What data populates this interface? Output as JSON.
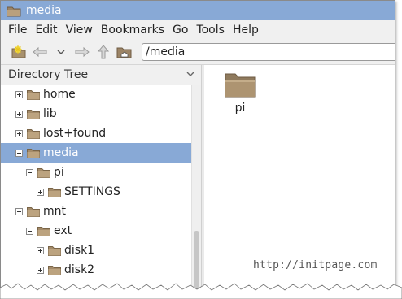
{
  "window": {
    "title": "media"
  },
  "menu": {
    "items": [
      "File",
      "Edit",
      "View",
      "Bookmarks",
      "Go",
      "Tools",
      "Help"
    ]
  },
  "toolbar": {
    "icons": [
      "new-tab-icon",
      "back-icon",
      "history-dropdown-icon",
      "forward-icon",
      "up-icon",
      "home-icon"
    ],
    "path": "/media"
  },
  "sidebar": {
    "header": "Directory Tree",
    "items": [
      {
        "label": "home",
        "expander": "+",
        "selected": false
      },
      {
        "label": "lib",
        "expander": "+",
        "selected": false
      },
      {
        "label": "lost+found",
        "expander": "+",
        "selected": false
      },
      {
        "label": "media",
        "expander": "-",
        "selected": true
      },
      {
        "label": "pi",
        "expander": "-",
        "selected": false
      },
      {
        "label": "SETTINGS",
        "expander": "+",
        "selected": false
      },
      {
        "label": "mnt",
        "expander": "-",
        "selected": false
      },
      {
        "label": "ext",
        "expander": "-",
        "selected": false
      },
      {
        "label": "disk1",
        "expander": "+",
        "selected": false
      },
      {
        "label": "disk2",
        "expander": "+",
        "selected": false
      }
    ]
  },
  "files": {
    "items": [
      {
        "label": "pi"
      }
    ]
  },
  "watermark": "http://initpage.com",
  "colors": {
    "selection": "#88a9d6",
    "titlebar": "#88a9d6",
    "folder": "#a89270"
  }
}
